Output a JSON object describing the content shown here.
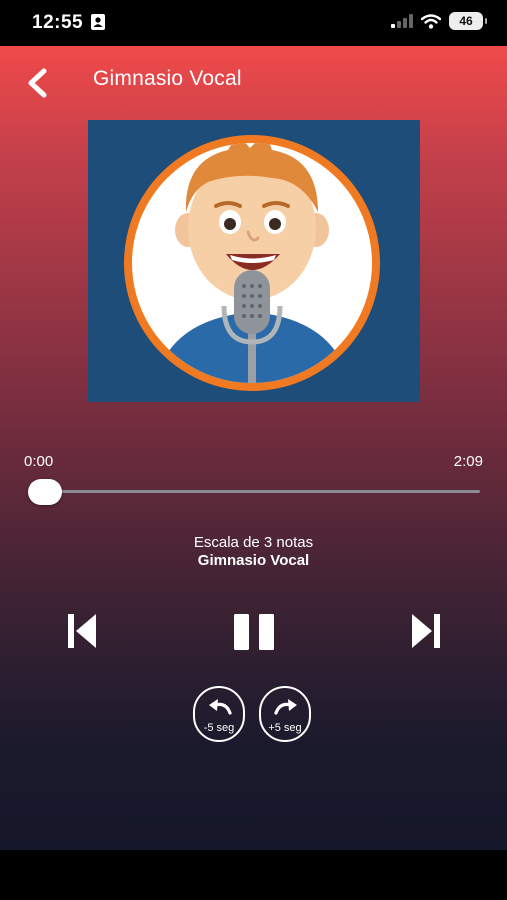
{
  "status_bar": {
    "time": "12:55",
    "battery": "46"
  },
  "header": {
    "title": "Gimnasio Vocal",
    "back_icon": "chevron-left-icon"
  },
  "cover": {
    "image": "cartoon-boy-microphone",
    "bg_color": "#1f4d7a",
    "ring_color": "#f07a22"
  },
  "player": {
    "current_time": "0:00",
    "total_time": "2:09",
    "progress": 0,
    "track_name": "Escala de 3 notas",
    "artist": "Gimnasio Vocal"
  },
  "controls": {
    "prev_icon": "skip-previous-icon",
    "pause_icon": "pause-icon",
    "next_icon": "skip-next-icon",
    "rewind_label": "-5 seg",
    "forward_label": "+5 seg"
  }
}
